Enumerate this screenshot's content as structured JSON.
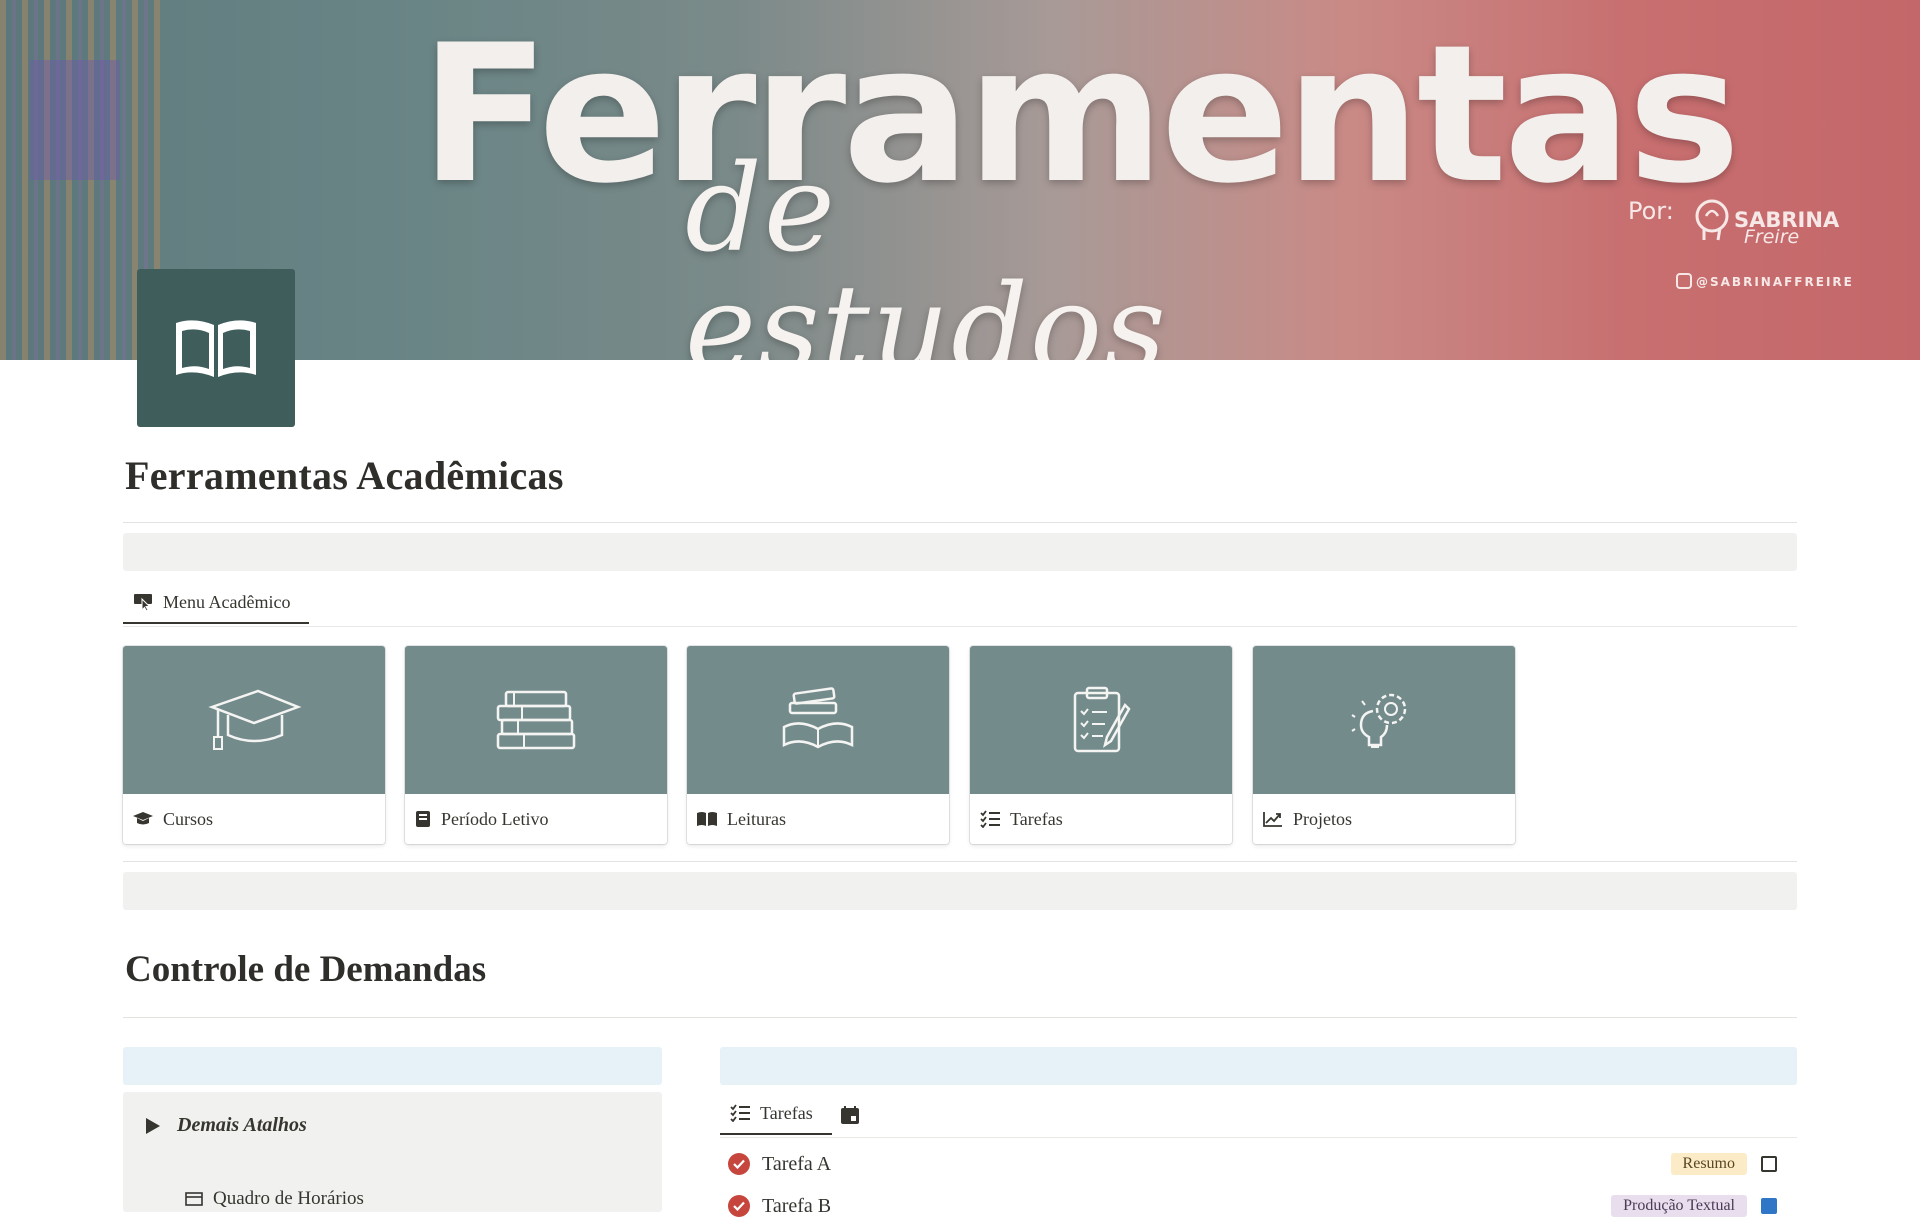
{
  "cover": {
    "title": "Ferramentas",
    "subtitle": "de estudos",
    "by_label": "Por:",
    "brand_line1": "SABRINA",
    "brand_line2": "Freire",
    "handle": "@SABRINAFFREIRE"
  },
  "page_icon": "book-open-icon",
  "page": {
    "title": "Ferramentas Acadêmicas"
  },
  "menu_tabs": [
    {
      "label": "Menu Acadêmico",
      "icon": "pointer-board-icon",
      "active": true
    }
  ],
  "gallery": [
    {
      "label": "Cursos",
      "icon": "graduation-cap-icon"
    },
    {
      "label": "Período Letivo",
      "icon": "notebook-icon"
    },
    {
      "label": "Leituras",
      "icon": "open-book-icon"
    },
    {
      "label": "Tarefas",
      "icon": "checklist-icon"
    },
    {
      "label": "Projetos",
      "icon": "trend-chart-icon"
    }
  ],
  "section2": {
    "title": "Controle de Demandas"
  },
  "toggle": {
    "label": "Demais Atalhos",
    "next_item": "Quadro de Horários"
  },
  "tasks_view": {
    "tab_label": "Tarefas",
    "calendar_icon": "calendar-icon"
  },
  "tasks": [
    {
      "name": "Tarefa A",
      "tag": "Resumo",
      "tag_color": "#fbecc7",
      "done": false
    },
    {
      "name": "Tarefa B",
      "tag": "Produção Textual",
      "tag_color": "#e8deee",
      "done": true
    }
  ],
  "colors": {
    "accent_teal": "#3e5d5b",
    "card_cover": "#748b8c",
    "check_red": "#c6463d",
    "callout_gray": "#f1f1ef",
    "callout_blue": "#e7f1f8"
  }
}
